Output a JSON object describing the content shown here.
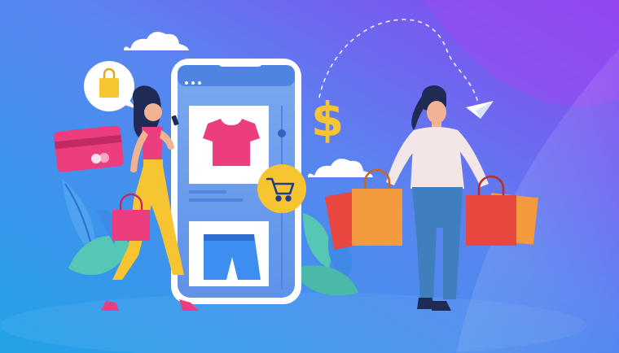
{
  "illustration": {
    "currency_symbol": "$",
    "colors": {
      "background_left": "#2f9fe6",
      "background_right": "#8a3ff0",
      "phone_screen": "#6fa0ec",
      "accent_yellow": "#f7c531",
      "accent_pink": "#ec3d7e",
      "shopping_bag_orange": "#f29a3d",
      "shopping_bag_red": "#e8483f"
    },
    "icons": [
      "cloud-icon",
      "shopping-bag-icon",
      "credit-card-icon",
      "paper-plane-icon",
      "shopping-cart-icon",
      "tshirt-icon",
      "shorts-icon",
      "dollar-sign-icon"
    ]
  }
}
